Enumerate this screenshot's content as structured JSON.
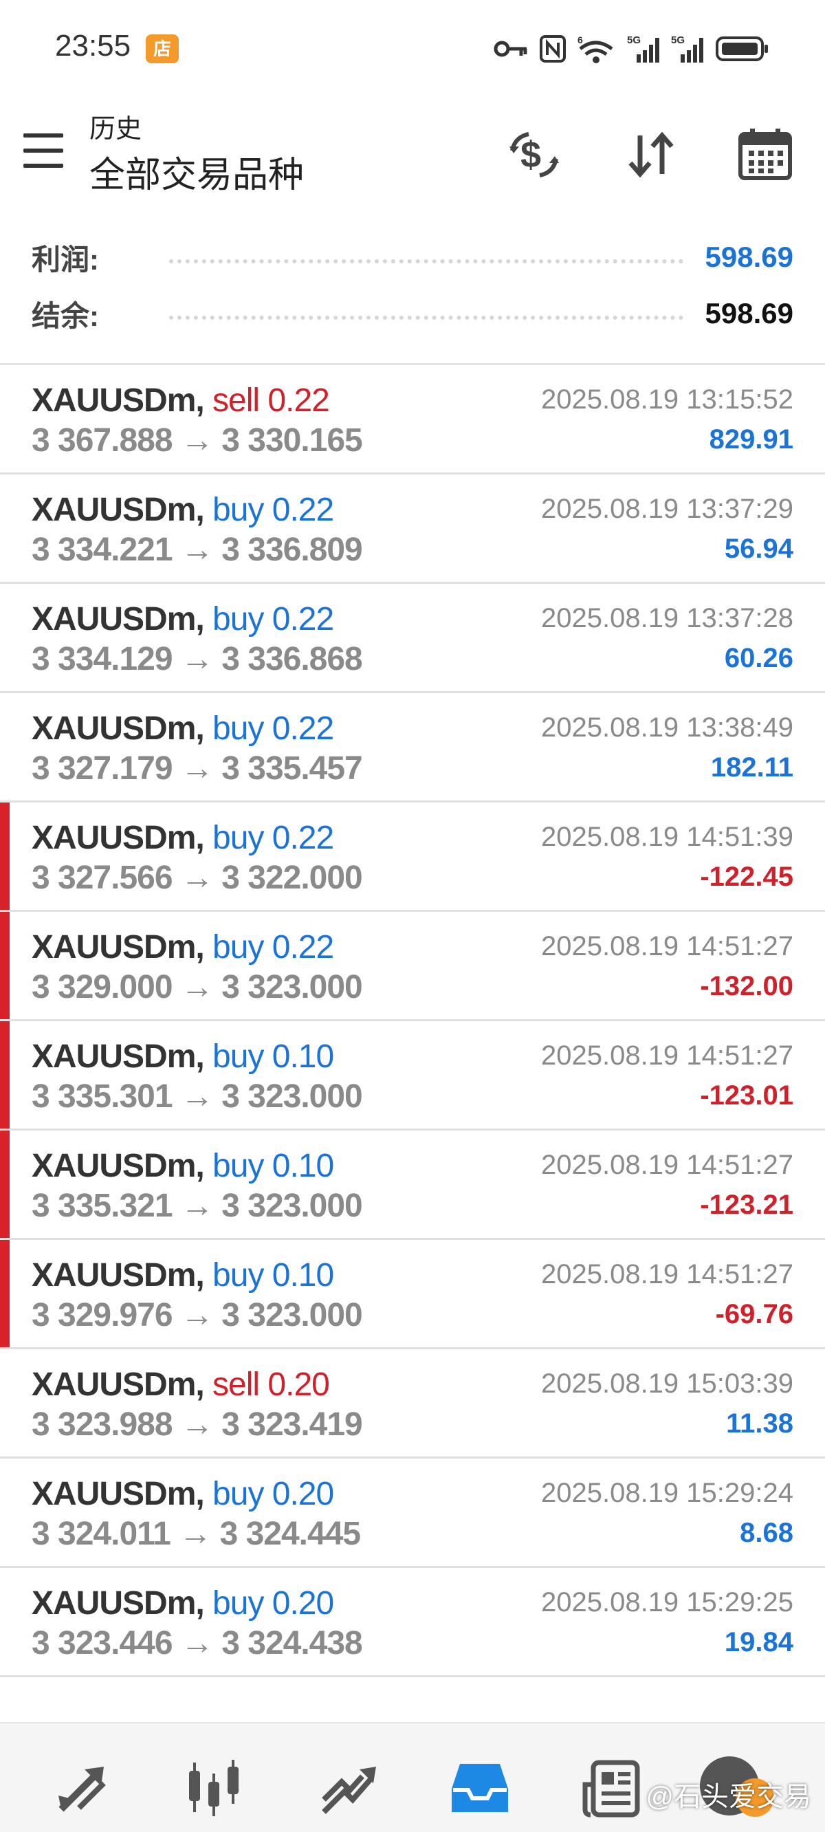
{
  "status_bar": {
    "time": "23:55",
    "app_badge": "店",
    "icons": [
      "key-icon",
      "nfc-icon",
      "wifi-6-icon",
      "signal-5g-1-icon",
      "signal-5g-2-icon",
      "battery-icon"
    ],
    "wifi_label": "6",
    "net1": "5G",
    "net2": "5G"
  },
  "header": {
    "subtitle": "历史",
    "title": "全部交易品种"
  },
  "summary": {
    "profit_label": "利润:",
    "profit_value": "598.69",
    "balance_label": "结余:",
    "balance_value": "598.69"
  },
  "colors": {
    "positive": "#1a73d9",
    "negative": "#d0202a",
    "buy": "#1a73d9",
    "sell": "#d0202a",
    "loss_marker": "#d9212a",
    "active_tab": "#1e88e5"
  },
  "trades": [
    {
      "symbol": "XAUUSDm,",
      "side": "sell 0.22",
      "side_type": "sell",
      "prices": "3 367.888 → 3 330.165",
      "time": "2025.08.19 13:15:52",
      "profit": "829.91",
      "profit_type": "positive"
    },
    {
      "symbol": "XAUUSDm,",
      "side": "buy 0.22",
      "side_type": "buy",
      "prices": "3 334.221 → 3 336.809",
      "time": "2025.08.19 13:37:29",
      "profit": "56.94",
      "profit_type": "positive"
    },
    {
      "symbol": "XAUUSDm,",
      "side": "buy 0.22",
      "side_type": "buy",
      "prices": "3 334.129 → 3 336.868",
      "time": "2025.08.19 13:37:28",
      "profit": "60.26",
      "profit_type": "positive"
    },
    {
      "symbol": "XAUUSDm,",
      "side": "buy 0.22",
      "side_type": "buy",
      "prices": "3 327.179 → 3 335.457",
      "time": "2025.08.19 13:38:49",
      "profit": "182.11",
      "profit_type": "positive"
    },
    {
      "symbol": "XAUUSDm,",
      "side": "buy 0.22",
      "side_type": "buy",
      "prices": "3 327.566 → 3 322.000",
      "time": "2025.08.19 14:51:39",
      "profit": "-122.45",
      "profit_type": "negative"
    },
    {
      "symbol": "XAUUSDm,",
      "side": "buy 0.22",
      "side_type": "buy",
      "prices": "3 329.000 → 3 323.000",
      "time": "2025.08.19 14:51:27",
      "profit": "-132.00",
      "profit_type": "negative"
    },
    {
      "symbol": "XAUUSDm,",
      "side": "buy 0.10",
      "side_type": "buy",
      "prices": "3 335.301 → 3 323.000",
      "time": "2025.08.19 14:51:27",
      "profit": "-123.01",
      "profit_type": "negative"
    },
    {
      "symbol": "XAUUSDm,",
      "side": "buy 0.10",
      "side_type": "buy",
      "prices": "3 335.321 → 3 323.000",
      "time": "2025.08.19 14:51:27",
      "profit": "-123.21",
      "profit_type": "negative"
    },
    {
      "symbol": "XAUUSDm,",
      "side": "buy 0.10",
      "side_type": "buy",
      "prices": "3 329.976 → 3 323.000",
      "time": "2025.08.19 14:51:27",
      "profit": "-69.76",
      "profit_type": "negative"
    },
    {
      "symbol": "XAUUSDm,",
      "side": "sell 0.20",
      "side_type": "sell",
      "prices": "3 323.988 → 3 323.419",
      "time": "2025.08.19 15:03:39",
      "profit": "11.38",
      "profit_type": "positive"
    },
    {
      "symbol": "XAUUSDm,",
      "side": "buy 0.20",
      "side_type": "buy",
      "prices": "3 324.011 → 3 324.445",
      "time": "2025.08.19 15:29:24",
      "profit": "8.68",
      "profit_type": "positive"
    },
    {
      "symbol": "XAUUSDm,",
      "side": "buy 0.20",
      "side_type": "buy",
      "prices": "3 323.446 → 3 324.438",
      "time": "2025.08.19 15:29:25",
      "profit": "19.84",
      "profit_type": "positive"
    }
  ],
  "bottom_nav": {
    "items": [
      "quotes-icon",
      "chart-icon",
      "trade-icon",
      "history-icon",
      "news-icon",
      "messages-icon"
    ],
    "active": "history-icon"
  },
  "watermark": {
    "text": "@石头爱交易"
  }
}
